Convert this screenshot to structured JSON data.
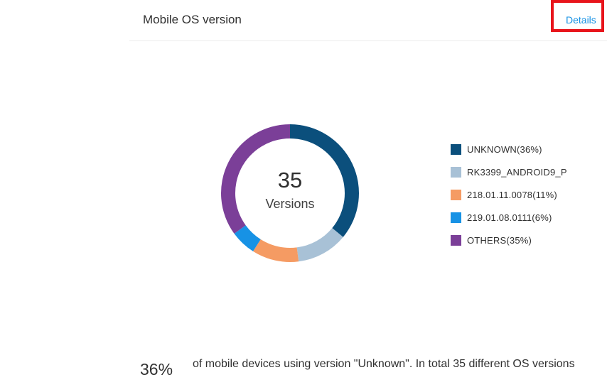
{
  "header": {
    "title": "Mobile OS version",
    "details_label": "Details"
  },
  "chart_data": {
    "type": "pie",
    "center_value": "35",
    "center_label": "Versions",
    "slices": [
      {
        "label": "UNKNOWN(36%)",
        "value": 36,
        "color": "#0b4f7c"
      },
      {
        "label": "RK3399_ANDROID9_P",
        "value": 12,
        "color": "#a8c1d6"
      },
      {
        "label": "218.01.11.0078(11%)",
        "value": 11,
        "color": "#f59b63"
      },
      {
        "label": "219.01.08.0111(6%)",
        "value": 6,
        "color": "#1792e5"
      },
      {
        "label": "OTHERS(35%)",
        "value": 35,
        "color": "#7b3f98"
      }
    ]
  },
  "summary": {
    "percent": "36%",
    "text": "of mobile devices using version \"Unknown\". In total 35 different OS versions"
  },
  "colors": {
    "link": "#1792e5",
    "highlight": "#e8141b"
  }
}
